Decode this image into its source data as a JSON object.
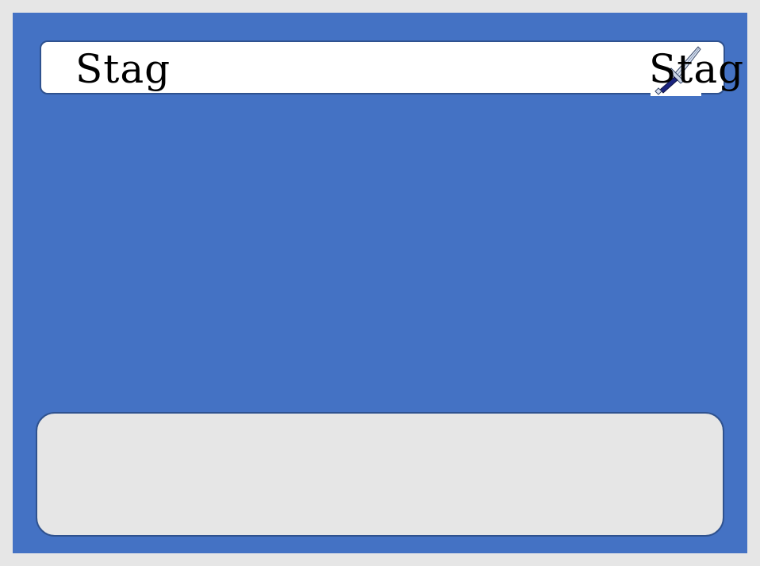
{
  "colors": {
    "frame": "#e6e6e6",
    "screen_background": "#4472c4",
    "border": "#2f528f",
    "name_bar": "#ffffff",
    "dialog_box": "#e6e6e6"
  },
  "hud": {
    "name_left": "Stag",
    "name_right": "Stag",
    "equipped_icon": "sword-icon"
  },
  "dialog": {
    "text": ""
  }
}
